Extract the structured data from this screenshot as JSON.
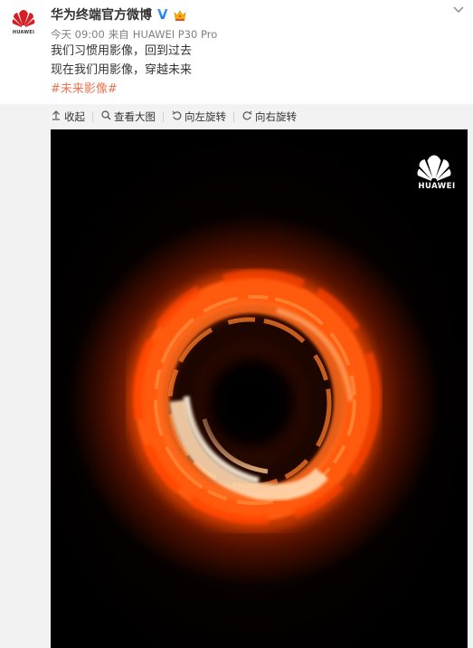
{
  "post": {
    "author": "华为终端官方微博",
    "verified_badge": "V",
    "timestamp": "今天 09:00",
    "source_prefix": "来自",
    "source": "HUAWEI P30 Pro",
    "lines": [
      "我们习惯用影像，回到过去",
      "现在我们用影像，穿越未来"
    ],
    "hashtag": "#未来影像#"
  },
  "avatar": {
    "wordmark": "HUAWEI"
  },
  "toolbar": {
    "collapse": "收起",
    "view_large": "查看大图",
    "rotate_left": "向左旋转",
    "rotate_right": "向右旋转"
  },
  "photo": {
    "logo_text": "HUAWEI"
  },
  "colors": {
    "brand_red": "#d41f26",
    "hashtag": "#eb7350",
    "verified": "#2f8df0",
    "ring_glow": "#ff5a00"
  },
  "icons": [
    "collapse-arrow-icon",
    "magnifier-icon",
    "rotate-left-icon",
    "rotate-right-icon",
    "chevron-down-icon",
    "huawei-flower-icon",
    "crown-icon"
  ]
}
